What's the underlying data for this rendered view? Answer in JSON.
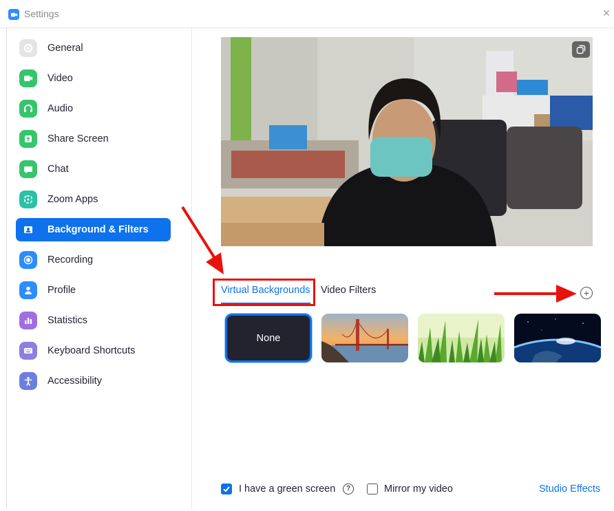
{
  "window": {
    "title": "Settings",
    "close_icon": "close-icon"
  },
  "sidebar": {
    "items": [
      {
        "label": "General",
        "icon": "gear-icon",
        "color": "#d6d6d6"
      },
      {
        "label": "Video",
        "icon": "video-camera-icon",
        "color": "#35c66c"
      },
      {
        "label": "Audio",
        "icon": "headphones-icon",
        "color": "#35c66c"
      },
      {
        "label": "Share Screen",
        "icon": "share-screen-icon",
        "color": "#35c66c"
      },
      {
        "label": "Chat",
        "icon": "chat-bubble-icon",
        "color": "#35c66c"
      },
      {
        "label": "Zoom Apps",
        "icon": "apps-icon",
        "color": "#2bc1a8"
      },
      {
        "label": "Background & Filters",
        "icon": "background-icon",
        "color": "#ffffff",
        "active": true
      },
      {
        "label": "Recording",
        "icon": "record-icon",
        "color": "#2d8cff"
      },
      {
        "label": "Profile",
        "icon": "person-icon",
        "color": "#2d8cff"
      },
      {
        "label": "Statistics",
        "icon": "bar-chart-icon",
        "color": "#a06ee0"
      },
      {
        "label": "Keyboard Shortcuts",
        "icon": "keyboard-icon",
        "color": "#8c7fe0"
      },
      {
        "label": "Accessibility",
        "icon": "accessibility-icon",
        "color": "#6c7fe0"
      }
    ]
  },
  "main": {
    "preview": {
      "alt": "camera-preview",
      "overlay_icon": "copy-icon"
    },
    "tabs": [
      {
        "label": "Virtual Backgrounds",
        "selected": true
      },
      {
        "label": "Video Filters",
        "selected": false
      }
    ],
    "add_icon": "plus-circle-icon",
    "backgrounds": [
      {
        "label": "None",
        "selected": true
      },
      {
        "label": "",
        "scene": "golden-gate-bridge"
      },
      {
        "label": "",
        "scene": "green-grass"
      },
      {
        "label": "",
        "scene": "earth-from-space"
      }
    ],
    "options": {
      "green_screen": {
        "label": "I have a green screen",
        "checked": true
      },
      "mirror": {
        "label": "Mirror my video",
        "checked": false
      }
    },
    "studio_effects": "Studio Effects"
  },
  "colors": {
    "accent": "#0e72ed",
    "annotation": "#e8120c"
  }
}
